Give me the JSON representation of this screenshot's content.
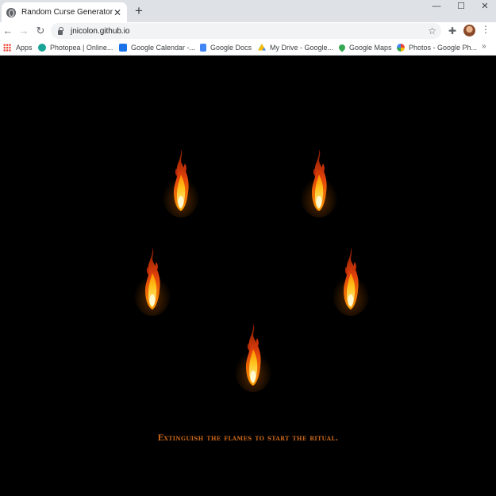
{
  "browser": {
    "tab_title": "Random Curse Generator",
    "tab_close_glyph": "✕",
    "new_tab_glyph": "+",
    "window_controls": {
      "minimize": "—",
      "maximize": "☐",
      "close": "✕"
    },
    "nav": {
      "back": "←",
      "forward": "→",
      "reload": "↻"
    },
    "url": "jnicolon.github.io",
    "bookmarks": [
      {
        "label": "Apps",
        "icon": "apps-grid-icon",
        "color": "#ea4335"
      },
      {
        "label": "Photopea | Online...",
        "icon": "photopea-icon",
        "color": "#18a497"
      },
      {
        "label": "Google Calendar -...",
        "icon": "calendar-icon",
        "color": "#1a73e8"
      },
      {
        "label": "Google Docs",
        "icon": "docs-icon",
        "color": "#4285f4"
      },
      {
        "label": "My Drive - Google...",
        "icon": "drive-icon",
        "color": "#fbbc04"
      },
      {
        "label": "Google Maps",
        "icon": "maps-icon",
        "color": "#34a853"
      },
      {
        "label": "Photos - Google Ph...",
        "icon": "photos-icon",
        "color": "#ea4335"
      }
    ],
    "bookmarks_overflow_glyph": "»"
  },
  "page": {
    "background": "#000000",
    "flames_count": 5,
    "instruction": "Extinguish the flames to start the ritual.",
    "instruction_color": "#c8661a"
  }
}
